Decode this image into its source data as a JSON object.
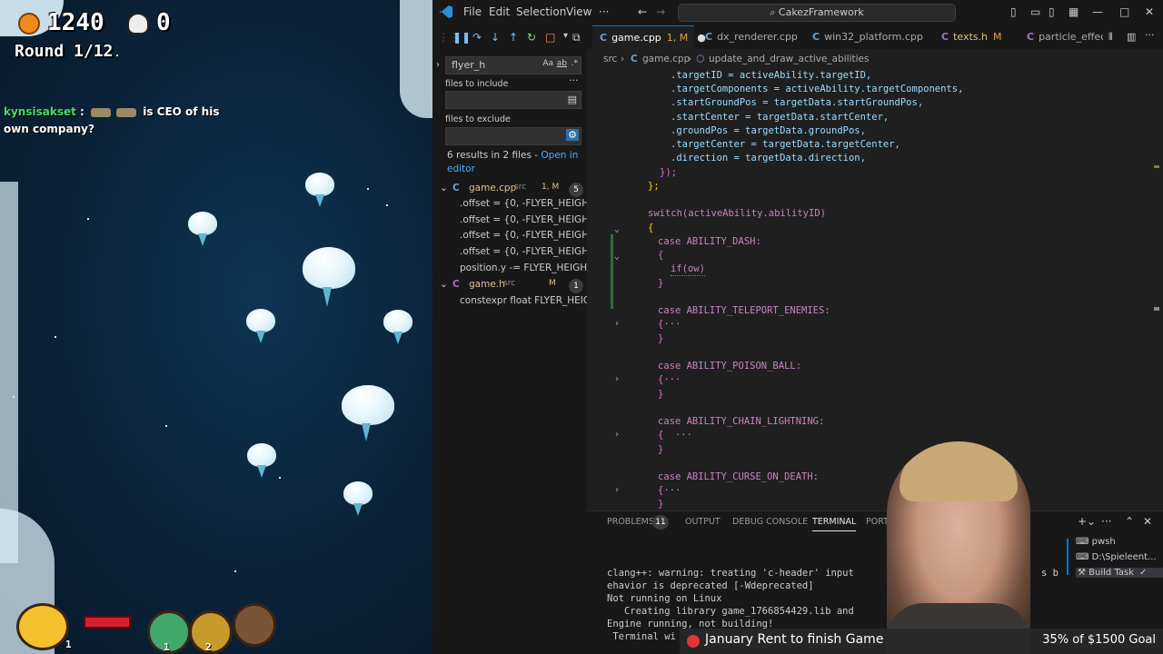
{
  "game": {
    "coins": "1240",
    "kills": "0",
    "round": "Round 1/12",
    "chat": {
      "user": "kynsisakset",
      "sep": ":",
      "message": "is CEO of his own company?"
    },
    "party_counts": [
      "1",
      "1",
      "2"
    ]
  },
  "titlebar": {
    "menu": [
      "File",
      "Edit",
      "Selection",
      "View",
      "···"
    ],
    "command_center": "CakezFramework"
  },
  "search": {
    "query": "flyer_h",
    "include_label": "files to include",
    "exclude_label": "files to exclude",
    "summary": "6 results in 2 files - ",
    "open_in_editor": "Open in editor",
    "files": [
      {
        "name": "game.cpp",
        "dir": "src",
        "status": "1, M",
        "count": "5",
        "matches": [
          ".offset = {0, -FLYER_HEIGHT - ...",
          ".offset = {0, -FLYER_HEIGHT - ...",
          ".offset = {0, -FLYER_HEIGHT - ...",
          ".offset = {0, -FLYER_HEIGHT - ...",
          "position.y -= FLYER_HEIGHT;"
        ]
      },
      {
        "name": "game.h",
        "dir": "src",
        "status": "M",
        "count": "1",
        "matches": [
          "constexpr float FLYER_HEIGHT..."
        ]
      }
    ]
  },
  "tabs": [
    {
      "label": "game.cpp",
      "status": "1, M",
      "active": true
    },
    {
      "label": "dx_renderer.cpp",
      "status": ""
    },
    {
      "label": "win32_platform.cpp",
      "status": ""
    },
    {
      "label": "texts.h",
      "status": "M"
    },
    {
      "label": "particle_effec",
      "status": ""
    }
  ],
  "breadcrumb": {
    "folder": "src",
    "file": "game.cpp",
    "symbol": "update_and_draw_active_abilities"
  },
  "code": [
    ".targetID = activeAbility.targetID,",
    ".targetComponents = activeAbility.targetComponents,",
    ".startGroundPos = targetData.startGroundPos,",
    ".startCenter = targetData.startCenter,",
    ".groundPos = targetData.groundPos,",
    ".targetCenter = targetData.targetCenter,",
    ".direction = targetData.direction,",
    "});",
    "};",
    "switch(activeAbility.abilityID)",
    "{",
    "case ABILITY_DASH:",
    "{",
    "if(ow)",
    "}",
    "case ABILITY_TELEPORT_ENEMIES:",
    "{···",
    "}",
    "case ABILITY_POISON_BALL:",
    "{···",
    "}",
    "case ABILITY_CHAIN_LIGHTNING:",
    "{  ···",
    "}",
    "case ABILITY_CURSE_ON_DEATH:",
    "{···",
    "}"
  ],
  "panel": {
    "tabs": [
      "PROBLEMS",
      "OUTPUT",
      "DEBUG CONSOLE",
      "TERMINAL",
      "PORTS"
    ],
    "problems_count": "11",
    "terminal_lines": [
      "clang++: warning: treating 'c-header' input",
      "ehavior is deprecated [-Wdeprecated]",
      "Not running on Linux",
      "   Creating library game_1766854429.lib and",
      "Engine running, not building!",
      " Terminal wi"
    ],
    "terminal_tail": "s b",
    "terminals": [
      "pwsh",
      "D:\\Spieleent...",
      "Build  Task"
    ]
  },
  "goal": {
    "title": "January Rent to finish Game",
    "progress": "35% of $1500 Goal"
  }
}
